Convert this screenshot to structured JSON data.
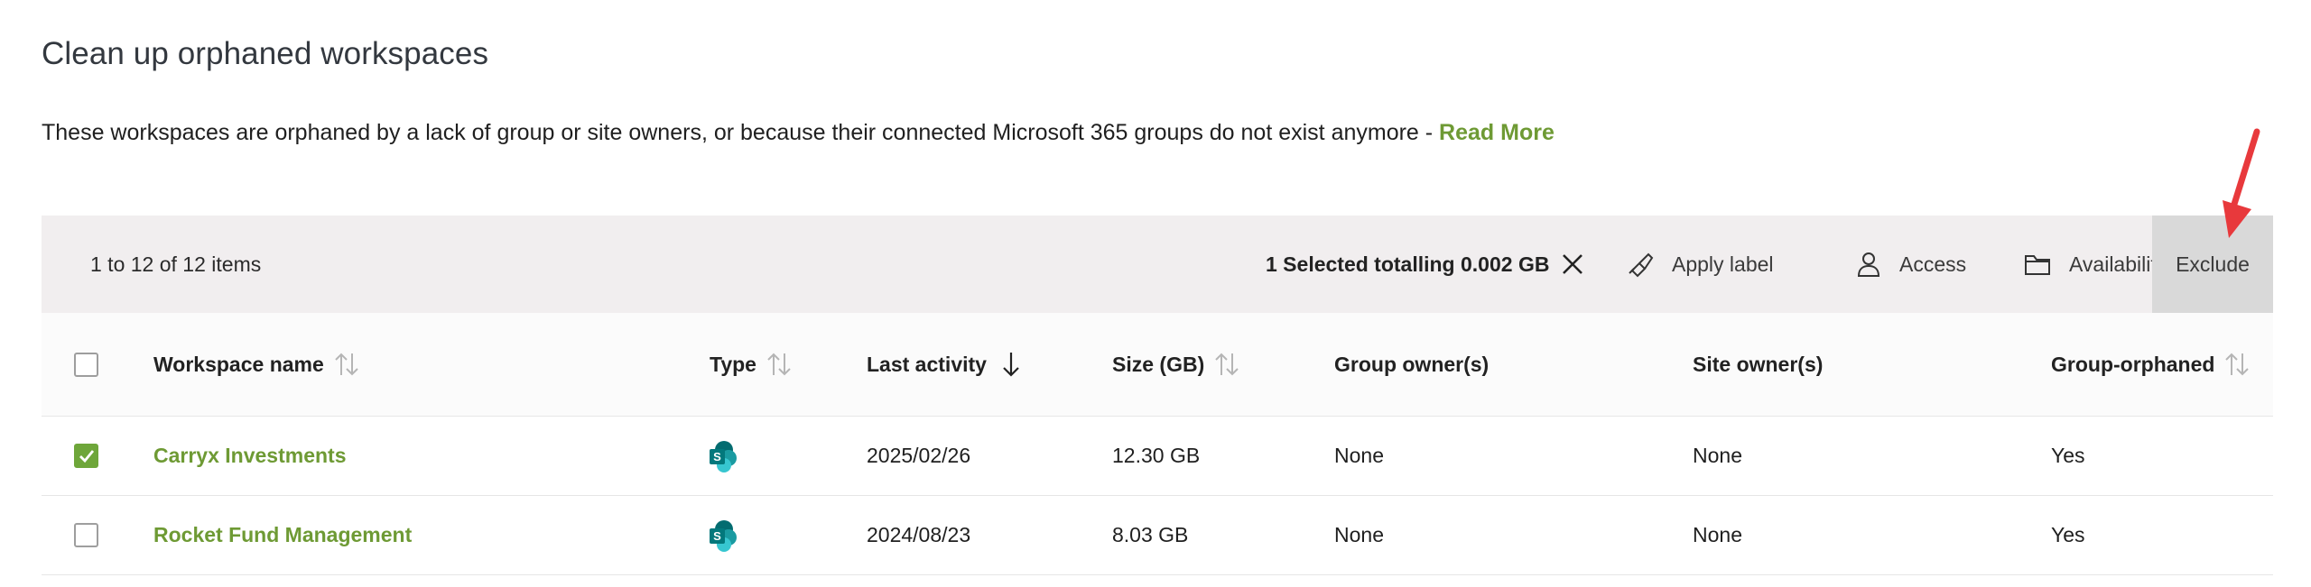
{
  "page": {
    "title": "Clean up orphaned workspaces",
    "description": "These workspaces are orphaned by a lack of group or site owners, or because their connected Microsoft 365 groups do not exist anymore - ",
    "read_more": "Read More"
  },
  "toolbar": {
    "count": "1 to 12 of 12 items",
    "selection": "1 Selected totalling 0.002 GB",
    "apply_label": "Apply label",
    "access": "Access",
    "availability": "Availability",
    "exclude": "Exclude"
  },
  "table": {
    "headers": {
      "workspace_name": "Workspace name",
      "type": "Type",
      "last_activity": "Last activity",
      "size": "Size (GB)",
      "group_owners": "Group owner(s)",
      "site_owners": "Site owner(s)",
      "group_orphaned": "Group-orphaned"
    },
    "rows": [
      {
        "checked": true,
        "name": "Carryx Investments",
        "type_icon": "sharepoint-icon",
        "last_activity": "2025/02/26",
        "size": "12.30 GB",
        "group_owners": "None",
        "site_owners": "None",
        "group_orphaned": "Yes"
      },
      {
        "checked": false,
        "name": "Rocket Fund Management",
        "type_icon": "sharepoint-icon",
        "last_activity": "2024/08/23",
        "size": "8.03 GB",
        "group_owners": "None",
        "site_owners": "None",
        "group_orphaned": "Yes"
      }
    ]
  },
  "colors": {
    "accent_green": "#6e9a34",
    "toolbar_bg": "#f1eeef",
    "exclude_highlight": "#d9d9d9",
    "annotation_arrow": "#e8393c"
  }
}
